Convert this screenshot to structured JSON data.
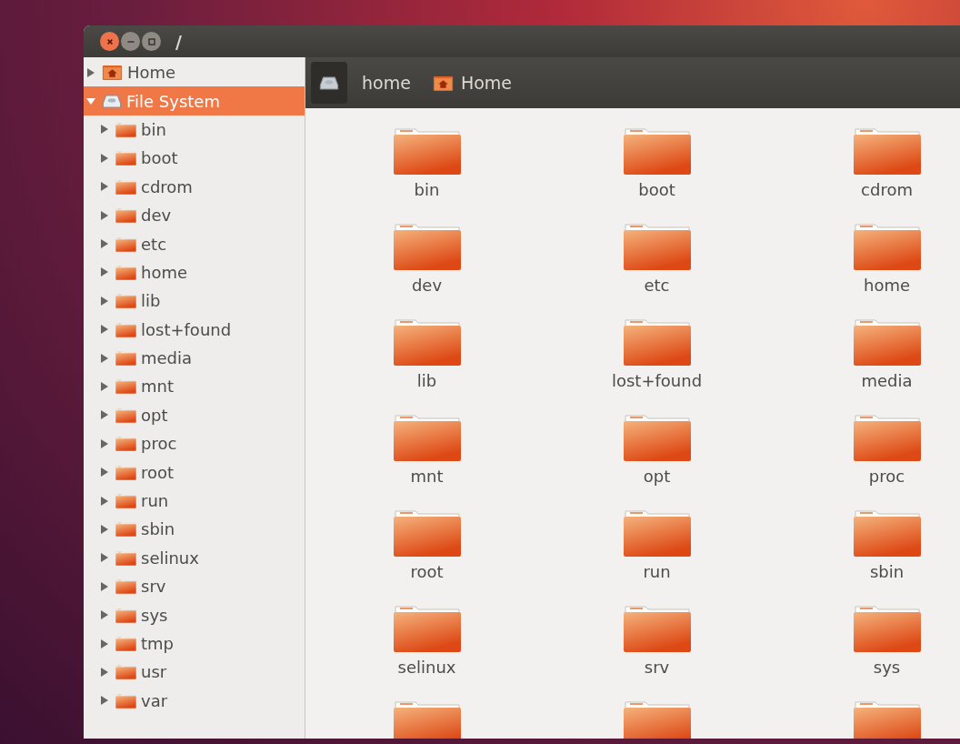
{
  "window": {
    "title": "/"
  },
  "sidebar": {
    "items": [
      {
        "label": "Home",
        "kind": "home",
        "expanded": false,
        "selected": false
      },
      {
        "label": "File System",
        "kind": "drive",
        "expanded": true,
        "selected": true,
        "children": [
          {
            "label": "bin",
            "expanded": false
          },
          {
            "label": "boot",
            "expanded": false
          },
          {
            "label": "cdrom",
            "expanded": false
          },
          {
            "label": "dev",
            "expanded": false
          },
          {
            "label": "etc",
            "expanded": false
          },
          {
            "label": "home",
            "expanded": false
          },
          {
            "label": "lib",
            "expanded": false
          },
          {
            "label": "lost+found",
            "expanded": false
          },
          {
            "label": "media",
            "expanded": false
          },
          {
            "label": "mnt",
            "expanded": false
          },
          {
            "label": "opt",
            "expanded": false
          },
          {
            "label": "proc",
            "expanded": false
          },
          {
            "label": "root",
            "expanded": false
          },
          {
            "label": "run",
            "expanded": false
          },
          {
            "label": "sbin",
            "expanded": false
          },
          {
            "label": "selinux",
            "expanded": false
          },
          {
            "label": "srv",
            "expanded": false
          },
          {
            "label": "sys",
            "expanded": false
          },
          {
            "label": "tmp",
            "expanded": false
          },
          {
            "label": "usr",
            "expanded": false
          },
          {
            "label": "var",
            "expanded": false
          }
        ]
      }
    ]
  },
  "breadcrumbs": [
    {
      "kind": "drive",
      "selected": true
    },
    {
      "kind": "text",
      "label": "home",
      "selected": false
    },
    {
      "kind": "home",
      "label": "Home",
      "selected": false
    }
  ],
  "items": [
    {
      "kind": "folder",
      "label": "bin"
    },
    {
      "kind": "folder",
      "label": "boot"
    },
    {
      "kind": "folder",
      "label": "cdrom"
    },
    {
      "kind": "folder",
      "label": "dev"
    },
    {
      "kind": "folder",
      "label": "etc"
    },
    {
      "kind": "folder",
      "label": "home"
    },
    {
      "kind": "folder",
      "label": "lib"
    },
    {
      "kind": "folder",
      "label": "lost+found"
    },
    {
      "kind": "folder",
      "label": "media"
    },
    {
      "kind": "folder",
      "label": "mnt"
    },
    {
      "kind": "folder",
      "label": "opt"
    },
    {
      "kind": "folder",
      "label": "proc"
    },
    {
      "kind": "folder",
      "label": "root"
    },
    {
      "kind": "folder",
      "label": "run"
    },
    {
      "kind": "folder",
      "label": "sbin"
    },
    {
      "kind": "folder",
      "label": "selinux"
    },
    {
      "kind": "folder",
      "label": "srv"
    },
    {
      "kind": "folder",
      "label": "sys"
    },
    {
      "kind": "folder"
    },
    {
      "kind": "folder"
    },
    {
      "kind": "folder"
    }
  ]
}
